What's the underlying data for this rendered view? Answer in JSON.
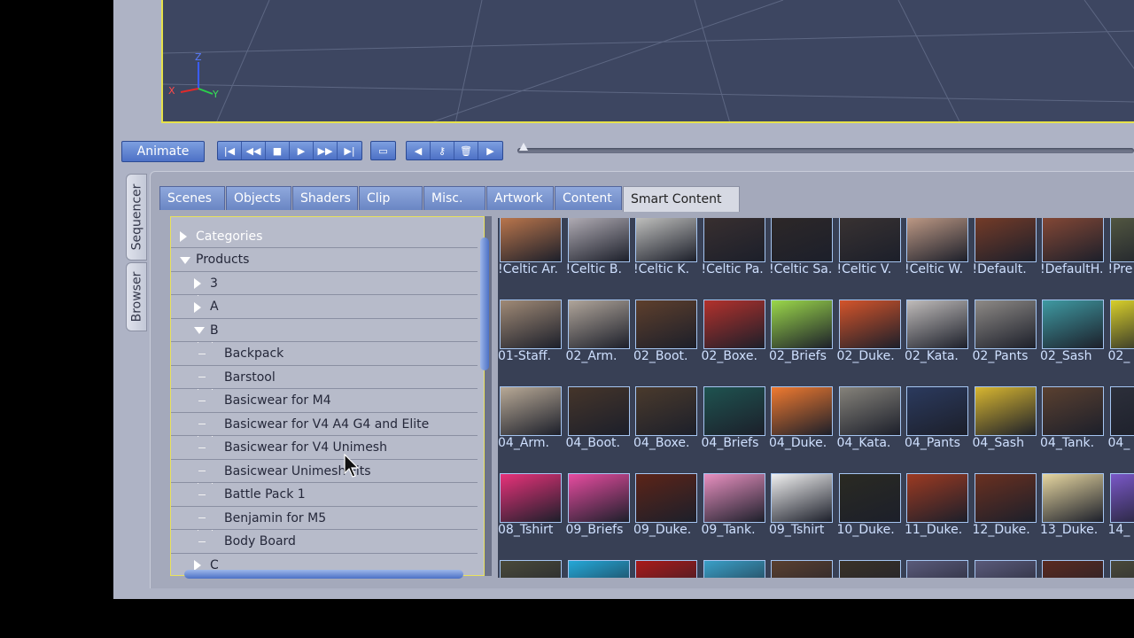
{
  "animate_button": "Animate",
  "transport_icons": [
    "first-frame-icon",
    "rewind-icon",
    "stop-icon",
    "play-icon",
    "fast-forward-icon",
    "last-frame-icon"
  ],
  "loop_icon": "loop-icon",
  "key_icons": [
    "prev-key-icon",
    "key-icon",
    "delete-key-icon",
    "next-key-icon"
  ],
  "side_tabs": [
    "Sequencer",
    "Browser"
  ],
  "tabs": [
    "Scenes",
    "Objects",
    "Shaders",
    "Clip",
    "Misc.",
    "Artwork",
    "Content",
    "Smart Content"
  ],
  "active_tab": "Smart Content",
  "axis": {
    "z": "Z",
    "x": "X",
    "y": "Y"
  },
  "tree": [
    {
      "label": "Categories",
      "expanded": false,
      "level": 0,
      "accent": true
    },
    {
      "label": "Products",
      "expanded": true,
      "level": 0
    },
    {
      "label": "3",
      "expanded": false,
      "level": 1
    },
    {
      "label": "A",
      "expanded": false,
      "level": 1
    },
    {
      "label": "B",
      "expanded": true,
      "level": 1
    },
    {
      "label": "Backpack",
      "level": 2
    },
    {
      "label": "Barstool",
      "level": 2
    },
    {
      "label": "Basicwear for M4",
      "level": 2
    },
    {
      "label": "Basicwear for V4 A4 G4 and Elite",
      "level": 2
    },
    {
      "label": "Basicwear for V4 Unimesh",
      "level": 2
    },
    {
      "label": "Basicwear Unimesh Fits",
      "level": 2
    },
    {
      "label": "Battle Pack 1",
      "level": 2
    },
    {
      "label": "Benjamin for M5",
      "level": 2
    },
    {
      "label": "Body Board",
      "level": 2
    },
    {
      "label": "C",
      "expanded": false,
      "level": 1
    }
  ],
  "grid_rows": [
    {
      "captions": [
        "!Celtic Ar.",
        "!Celtic B.",
        "!Celtic K.",
        "!Celtic Pa.",
        "!Celtic Sa.",
        "!Celtic V.",
        "!Celtic W.",
        "!Default.",
        "!DefaultH.",
        "!Pre"
      ],
      "colors": [
        "#c47b4e",
        "#b9b4bc",
        "#c9c9c6",
        "#3a3030",
        "#2e2828",
        "#3a3332",
        "#c7a08a",
        "#7a3d28",
        "#8a4a36",
        "#555a42"
      ]
    },
    {
      "captions": [
        "01-Staff.",
        "02_Arm.",
        "02_Boot.",
        "02_Boxe.",
        "02_Briefs",
        "02_Duke.",
        "02_Kata.",
        "02_Pants",
        "02_Sash",
        "02_"
      ],
      "colors": [
        "#a08a76",
        "#b0a59a",
        "#5e3f2c",
        "#b3312c",
        "#9bd84a",
        "#d4542a",
        "#c0bcba",
        "#8e8a86",
        "#3f9aa2",
        "#d8cf2a"
      ]
    },
    {
      "captions": [
        "04_Arm.",
        "04_Boot.",
        "04_Boxe.",
        "04_Briefs",
        "04_Duke.",
        "04_Kata.",
        "04_Pants",
        "04_Sash",
        "04_Tank.",
        "04_"
      ],
      "colors": [
        "#b8a996",
        "#45352a",
        "#4a3a2c",
        "#1e5350",
        "#f07a30",
        "#85827a",
        "#2b3a5e",
        "#d8b630",
        "#5a4030",
        "#2c2f3a"
      ]
    },
    {
      "captions": [
        "08_Tshirt",
        "09_Briefs",
        "09_Duke.",
        "09_Tank.",
        "09_Tshirt",
        "10_Duke.",
        "11_Duke.",
        "12_Duke.",
        "13_Duke.",
        "14_"
      ],
      "colors": [
        "#e8327a",
        "#e74ca0",
        "#5c2418",
        "#e890c0",
        "#f0f0f0",
        "#2a2a22",
        "#9c3a22",
        "#6a3020",
        "#e6d6a0",
        "#7a58c8"
      ]
    },
    {
      "captions": [
        "",
        "",
        "",
        "",
        "",
        "",
        "",
        "",
        "",
        ""
      ],
      "colors": [
        "#4a4a3a",
        "#24a8d8",
        "#aa1a1a",
        "#3aa0c8",
        "#5a4030",
        "#3a3228",
        "#5a5a7a",
        "#5a5a7a",
        "#5a2a20",
        "#4a4a3a"
      ]
    }
  ]
}
